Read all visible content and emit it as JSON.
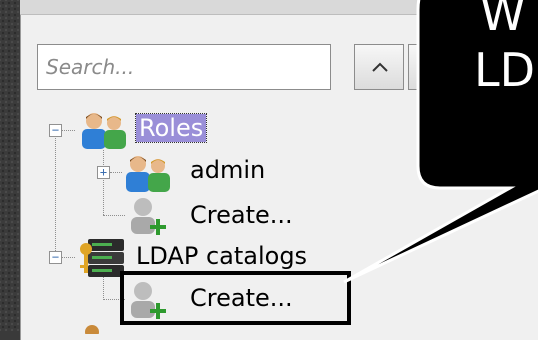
{
  "search": {
    "placeholder": "Search..."
  },
  "tree": {
    "roles": {
      "label": "Roles",
      "expander": "−"
    },
    "admin": {
      "label": "admin",
      "expander": "+"
    },
    "roles_create": {
      "label": "Create..."
    },
    "ldap": {
      "label": "LDAP catalogs",
      "expander": "−"
    },
    "ldap_create": {
      "label": "Create..."
    }
  },
  "callout": {
    "line1": "W",
    "line2": "LD"
  },
  "colors": {
    "selection": "#9a8fd8",
    "callout": "#000000",
    "panel": "#f0f0f0"
  },
  "icons": [
    "users-group-icon",
    "user-add-icon",
    "ldap-server-key-icon",
    "chevron-up-icon"
  ]
}
